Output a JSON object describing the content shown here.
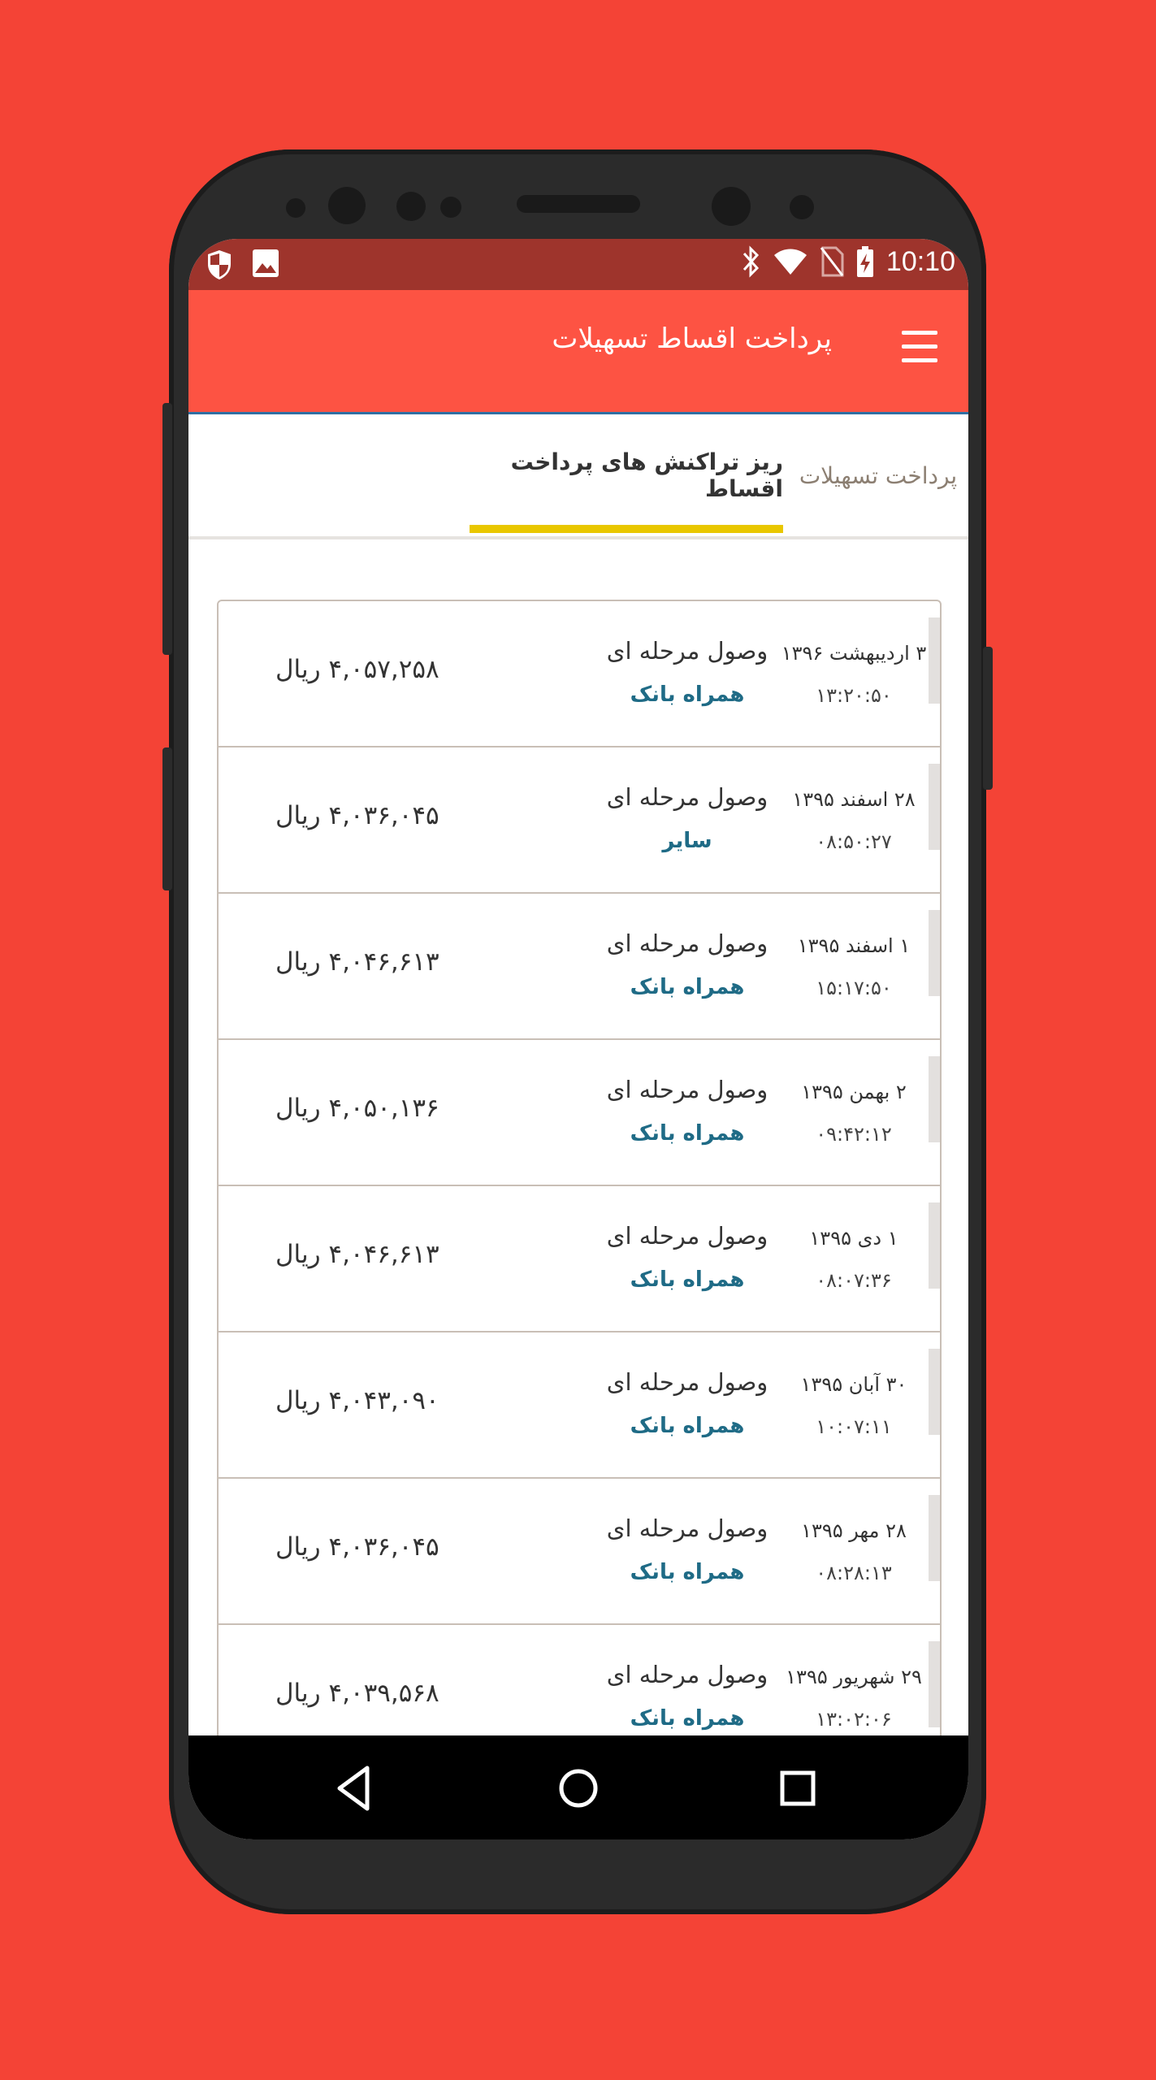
{
  "status_bar": {
    "time": "10:10",
    "left_icons": [
      "shield-icon",
      "image-icon"
    ],
    "right_icons": [
      "bluetooth-icon",
      "wifi-icon",
      "no-sim-icon",
      "battery-charging-icon"
    ]
  },
  "app_bar": {
    "title": "پرداخت اقساط تسهیلات",
    "menu_icon": "hamburger-menu-icon"
  },
  "tabs": [
    {
      "label": "پرداخت تسهیلات",
      "active": false
    },
    {
      "label": "ریز تراکنش های پرداخت اقساط",
      "active": true
    }
  ],
  "colors": {
    "app_bar": "#fd5343",
    "status_bar": "#9e342c",
    "tab_indicator": "#e9c700",
    "background": "#f44336",
    "channel_text": "#1f6b86"
  },
  "transactions": [
    {
      "date": "۳ اردیبهشت ۱۳۹۶",
      "time": "۱۳:۲۰:۵۰",
      "title": "وصول مرحله ای",
      "channel": "همراه بانک",
      "amount": "۴,۰۵۷,۲۵۸ ریال"
    },
    {
      "date": "۲۸ اسفند ۱۳۹۵",
      "time": "۰۸:۵۰:۲۷",
      "title": "وصول مرحله ای",
      "channel": "سایر",
      "amount": "۴,۰۳۶,۰۴۵ ریال"
    },
    {
      "date": "۱ اسفند ۱۳۹۵",
      "time": "۱۵:۱۷:۵۰",
      "title": "وصول مرحله ای",
      "channel": "همراه بانک",
      "amount": "۴,۰۴۶,۶۱۳ ریال"
    },
    {
      "date": "۲ بهمن ۱۳۹۵",
      "time": "۰۹:۴۲:۱۲",
      "title": "وصول مرحله ای",
      "channel": "همراه بانک",
      "amount": "۴,۰۵۰,۱۳۶ ریال"
    },
    {
      "date": "۱ دی ۱۳۹۵",
      "time": "۰۸:۰۷:۳۶",
      "title": "وصول مرحله ای",
      "channel": "همراه بانک",
      "amount": "۴,۰۴۶,۶۱۳ ریال"
    },
    {
      "date": "۳۰ آبان ۱۳۹۵",
      "time": "۱۰:۰۷:۱۱",
      "title": "وصول مرحله ای",
      "channel": "همراه بانک",
      "amount": "۴,۰۴۳,۰۹۰ ریال"
    },
    {
      "date": "۲۸ مهر ۱۳۹۵",
      "time": "۰۸:۲۸:۱۳",
      "title": "وصول مرحله ای",
      "channel": "همراه بانک",
      "amount": "۴,۰۳۶,۰۴۵ ریال"
    },
    {
      "date": "۲۹ شهریور ۱۳۹۵",
      "time": "۱۳:۰۲:۰۶",
      "title": "وصول مرحله ای",
      "channel": "همراه بانک",
      "amount": "۴,۰۳۹,۵۶۸ ریال"
    }
  ],
  "nav_bar": {
    "buttons": [
      "back-icon",
      "home-icon",
      "recents-icon"
    ]
  }
}
